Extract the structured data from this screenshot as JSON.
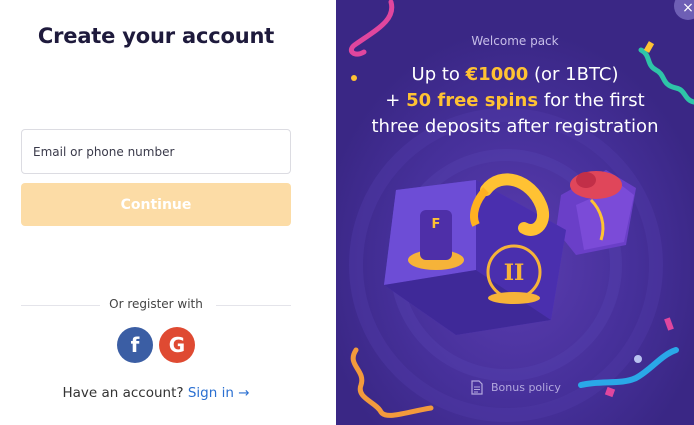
{
  "form": {
    "title": "Create your account",
    "email_placeholder": "Email or phone number",
    "continue_label": "Continue",
    "or_register_label": "Or register with",
    "facebook_glyph": "f",
    "google_glyph": "G",
    "have_account_text": "Have an account?",
    "sign_in_label": "Sign in",
    "sign_in_arrow": "→"
  },
  "promo": {
    "welcome_label": "Welcome pack",
    "line1_prefix": "Up to ",
    "line1_highlight": "€1000",
    "line1_suffix": " (or 1BTC)",
    "line2_prefix": "+ ",
    "line2_highlight": "50 free spins",
    "line2_suffix": " for the first",
    "line3": "three deposits after registration",
    "bonus_policy_label": "Bonus policy",
    "close_glyph": "×"
  },
  "colors": {
    "accent_orange": "#ffc233",
    "continue_disabled": "#fcdca6",
    "panel_purple": "#3d2a8a",
    "link_blue": "#2a6fd1",
    "facebook_blue": "#3b5ea4",
    "google_red": "#df4a32"
  },
  "icons": [
    "facebook-icon",
    "google-icon",
    "document-icon",
    "close-icon",
    "gift-boxes-illustration",
    "confetti-icon"
  ]
}
